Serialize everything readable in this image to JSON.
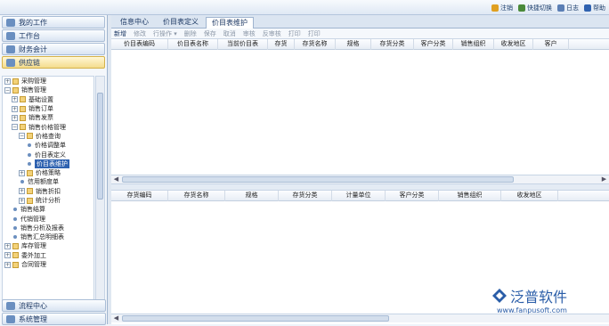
{
  "toplinks": [
    {
      "label": "注销",
      "color": "#e0a020"
    },
    {
      "label": "快捷切换",
      "color": "#4a8a3a"
    },
    {
      "label": "日志",
      "color": "#5b7fb5"
    },
    {
      "label": "帮助",
      "color": "#2f62b0"
    }
  ],
  "sidebar": {
    "top_accordions": [
      {
        "label": "我的工作",
        "active": false
      },
      {
        "label": "工作台",
        "active": false
      },
      {
        "label": "财务会计",
        "active": false
      },
      {
        "label": "供应链",
        "active": true
      }
    ],
    "tree": [
      {
        "level": 0,
        "type": "folder",
        "label": "采购管理"
      },
      {
        "level": 0,
        "type": "folder",
        "label": "销售管理",
        "expanded": true
      },
      {
        "level": 1,
        "type": "folder",
        "label": "基础设置"
      },
      {
        "level": 1,
        "type": "folder",
        "label": "销售订单"
      },
      {
        "level": 1,
        "type": "folder",
        "label": "销售发票"
      },
      {
        "level": 1,
        "type": "folder",
        "label": "销售价格管理",
        "expanded": true
      },
      {
        "level": 2,
        "type": "folder",
        "label": "价格查询",
        "expanded": true
      },
      {
        "level": 3,
        "type": "leaf",
        "label": "价格调整单"
      },
      {
        "level": 3,
        "type": "leaf",
        "label": "价目表定义"
      },
      {
        "level": 3,
        "type": "leaf",
        "label": "价目表维护",
        "selected": true
      },
      {
        "level": 2,
        "type": "folder",
        "label": "价格策略"
      },
      {
        "level": 2,
        "type": "leaf",
        "label": "信用额度单"
      },
      {
        "level": 2,
        "type": "folder",
        "label": "销售折扣"
      },
      {
        "level": 2,
        "type": "folder",
        "label": "统计分析"
      },
      {
        "level": 1,
        "type": "leaf",
        "label": "销售结算"
      },
      {
        "level": 1,
        "type": "leaf",
        "label": "代销管理"
      },
      {
        "level": 1,
        "type": "leaf",
        "label": "销售分析及报表"
      },
      {
        "level": 1,
        "type": "leaf",
        "label": "销售汇总明细表"
      },
      {
        "level": 0,
        "type": "folder",
        "label": "库存管理"
      },
      {
        "level": 0,
        "type": "folder",
        "label": "委外加工"
      },
      {
        "level": 0,
        "type": "folder",
        "label": "合同管理"
      }
    ],
    "bottom_accordions": [
      {
        "label": "流程中心"
      },
      {
        "label": "系统管理"
      }
    ]
  },
  "tabs": [
    {
      "label": "信息中心",
      "active": false
    },
    {
      "label": "价目表定义",
      "active": false
    },
    {
      "label": "价目表维护",
      "active": true
    }
  ],
  "toolbar": [
    "新增",
    "修改",
    "行操作 ▾",
    "删除",
    "保存",
    "取消",
    "审核",
    "反审核",
    "打印",
    "打印"
  ],
  "upper_grid": {
    "columns": [
      "价目表编码",
      "价目表名称",
      "当前价目表",
      "存货",
      "存货名称",
      "规格",
      "存货分类",
      "客户分类",
      "销售组织",
      "收发地区",
      "客户"
    ]
  },
  "lower_grid": {
    "columns": [
      "存货编码",
      "存货名称",
      "规格",
      "存货分类",
      "计量单位",
      "客户分类",
      "销售组织",
      "收发地区"
    ]
  },
  "logo": {
    "name": "泛普软件",
    "url": "www.fanpusoft.com",
    "color": "#2a5da8"
  }
}
